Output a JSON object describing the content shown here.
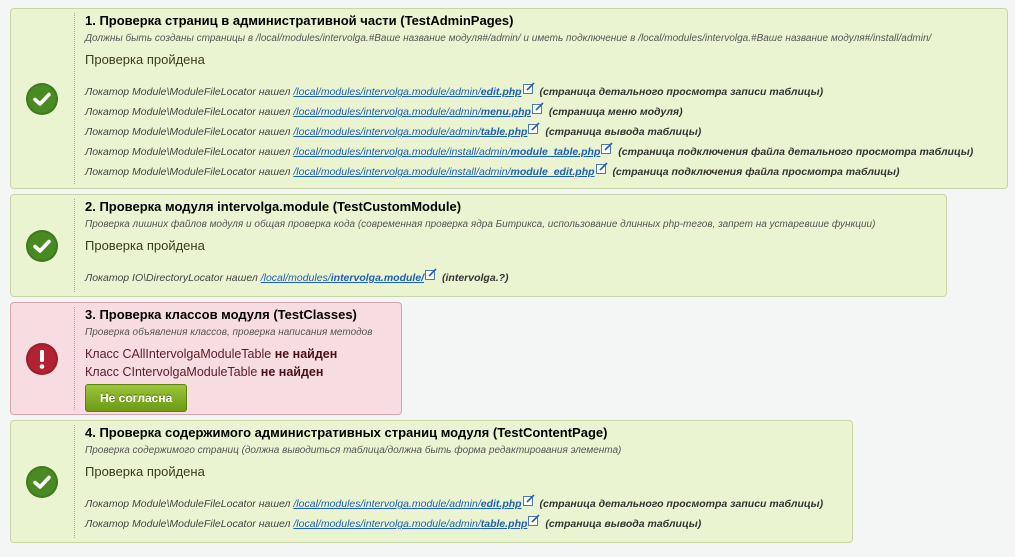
{
  "checks": [
    {
      "title": "1. Проверка страниц в административной части (TestAdminPages)",
      "description": "Должны быть созданы страницы в /local/modules/intervolga.#Ваше название модуля#/admin/ и иметь подключение в /local/modules/intervolga.#Ваше название модуля#/install/admin/",
      "status": "Проверка пройдена",
      "lines": [
        {
          "prefix": "Локатор Module\\ModuleFileLocator нашел",
          "path": "/local/modules/intervolga.module/admin/",
          "file": "edit.php",
          "note": "(страница детального просмотра записи таблицы)"
        },
        {
          "prefix": "Локатор Module\\ModuleFileLocator нашел",
          "path": "/local/modules/intervolga.module/admin/",
          "file": "menu.php",
          "note": "(страница меню модуля)"
        },
        {
          "prefix": "Локатор Module\\ModuleFileLocator нашел",
          "path": "/local/modules/intervolga.module/admin/",
          "file": "table.php",
          "note": "(страница вывода таблицы)"
        },
        {
          "prefix": "Локатор Module\\ModuleFileLocator нашел",
          "path": "/local/modules/intervolga.module/install/admin/",
          "file": "module_table.php",
          "note": "(страница подключения файла детального просмотра таблицы)"
        },
        {
          "prefix": "Локатор Module\\ModuleFileLocator нашел",
          "path": "/local/modules/intervolga.module/install/admin/",
          "file": "module_edit.php",
          "note": "(страница подключения файла просмотра таблицы)"
        }
      ]
    },
    {
      "title": "2. Проверка модуля intervolga.module (TestCustomModule)",
      "description": "Проверка лишних файлов модуля и общая проверка кода (современная проверка ядра Битрикса, использование длинных php-тегов, запрет на устаревшие функции)",
      "status": "Проверка пройдена",
      "lines": [
        {
          "prefix": "Локатор IO\\DirectoryLocator нашел",
          "path": "/local/modules/",
          "file": "intervolga.module/",
          "note": "(intervolga.?)"
        }
      ]
    },
    {
      "title": "3. Проверка классов модуля (TestClasses)",
      "description": "Проверка объявления классов, проверка написания методов",
      "errors": [
        {
          "text": "Класс CAllIntervolgaModuleTable",
          "strong": "не найден"
        },
        {
          "text": "Класс CIntervolgaModuleTable",
          "strong": "не найден"
        }
      ],
      "button": "Не согласна"
    },
    {
      "title": "4. Проверка содержимого административных страниц модуля (TestContentPage)",
      "description": "Проверка содержимого страниц (должна выводиться таблица/должна быть форма редактирования элемента)",
      "status": "Проверка пройдена",
      "lines": [
        {
          "prefix": "Локатор Module\\ModuleFileLocator нашел",
          "path": "/local/modules/intervolga.module/admin/",
          "file": "edit.php",
          "note": "(страница детального просмотра записи таблицы)"
        },
        {
          "prefix": "Локатор Module\\ModuleFileLocator нашел",
          "path": "/local/modules/intervolga.module/admin/",
          "file": "table.php",
          "note": "(страница вывода таблицы)"
        }
      ]
    }
  ],
  "colors": {
    "success": "#3e7a1c",
    "error": "#b22233"
  }
}
